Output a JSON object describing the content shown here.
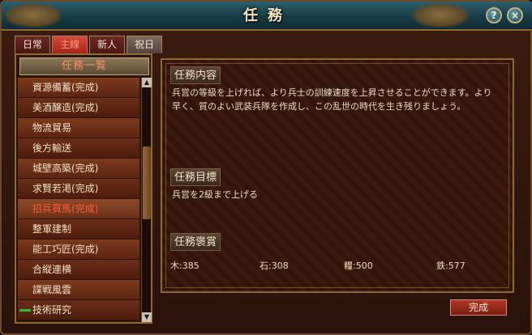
{
  "window": {
    "title": "任務",
    "help_label": "?",
    "close_label": "×"
  },
  "tabs": [
    {
      "label": "日常",
      "state": "normal"
    },
    {
      "label": "主線",
      "state": "active"
    },
    {
      "label": "新人",
      "state": "normal"
    },
    {
      "label": "祝日",
      "state": "dim"
    }
  ],
  "task_list": {
    "header": "任務一覧",
    "items": [
      {
        "label": "資源備蓄(完成)"
      },
      {
        "label": "美酒醸造(完成)"
      },
      {
        "label": "物流貿易"
      },
      {
        "label": "後方輸送"
      },
      {
        "label": "城壁高築(完成)"
      },
      {
        "label": "求賢若渇(完成)"
      },
      {
        "label": "招兵買馬(完成)",
        "selected": true
      },
      {
        "label": "整軍建制"
      },
      {
        "label": "能工巧匠(完成)"
      },
      {
        "label": "合縦連横"
      },
      {
        "label": "諜戦風雲"
      },
      {
        "label": "技術研究",
        "marked": true
      }
    ],
    "scroll_up": "▲",
    "scroll_down": "▼"
  },
  "detail": {
    "content_title": "任務内容",
    "content_text": "兵営の等級を上げれば、より兵士の訓練速度を上昇させることができます。より早く、質のよい武装兵隊を作成し、この乱世の時代を生き残りましょう。",
    "goal_title": "任務目標",
    "goal_text": "兵営を2級まで上げる",
    "reward_title": "任務褒賞",
    "rewards": [
      {
        "text": "木:385"
      },
      {
        "text": "石:308"
      },
      {
        "text": "糧:500"
      },
      {
        "text": "鉄:577"
      }
    ]
  },
  "complete_button": "完成",
  "colors": {
    "accent_red": "#a82418",
    "selected_text": "#ff5a3a",
    "title_bar": "#183c46",
    "progress_mark": "#2fbf2f"
  }
}
